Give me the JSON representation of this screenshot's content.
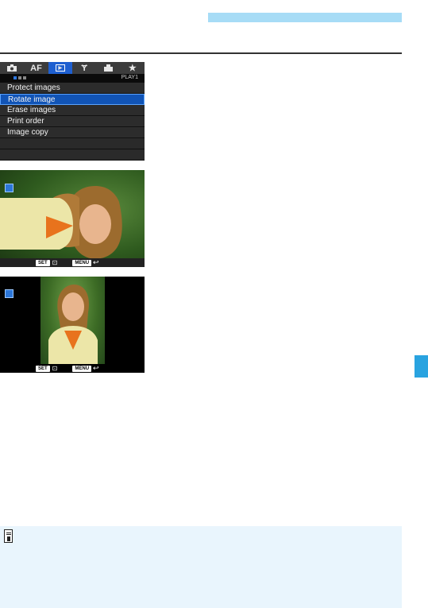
{
  "menu": {
    "tabs": [
      "",
      "AF",
      "",
      "",
      "",
      ""
    ],
    "play_label": "PLAY1",
    "items": [
      "Protect images",
      "Rotate image",
      "Erase images",
      "Print order",
      "Image copy"
    ],
    "selected_index": 1,
    "page_dots": 3
  },
  "screen1": {
    "set_label": "SET",
    "menu_label": "MENU"
  },
  "screen2": {
    "set_label": "SET",
    "menu_label": "MENU"
  },
  "colors": {
    "header_band": "#a7dcf6",
    "side_tab": "#29a3e0",
    "note_background": "#e9f5fd",
    "menu_highlight": "#1154b6"
  },
  "icons": {
    "note": "memo-icon",
    "rotate": "camera-rotate-icon"
  }
}
